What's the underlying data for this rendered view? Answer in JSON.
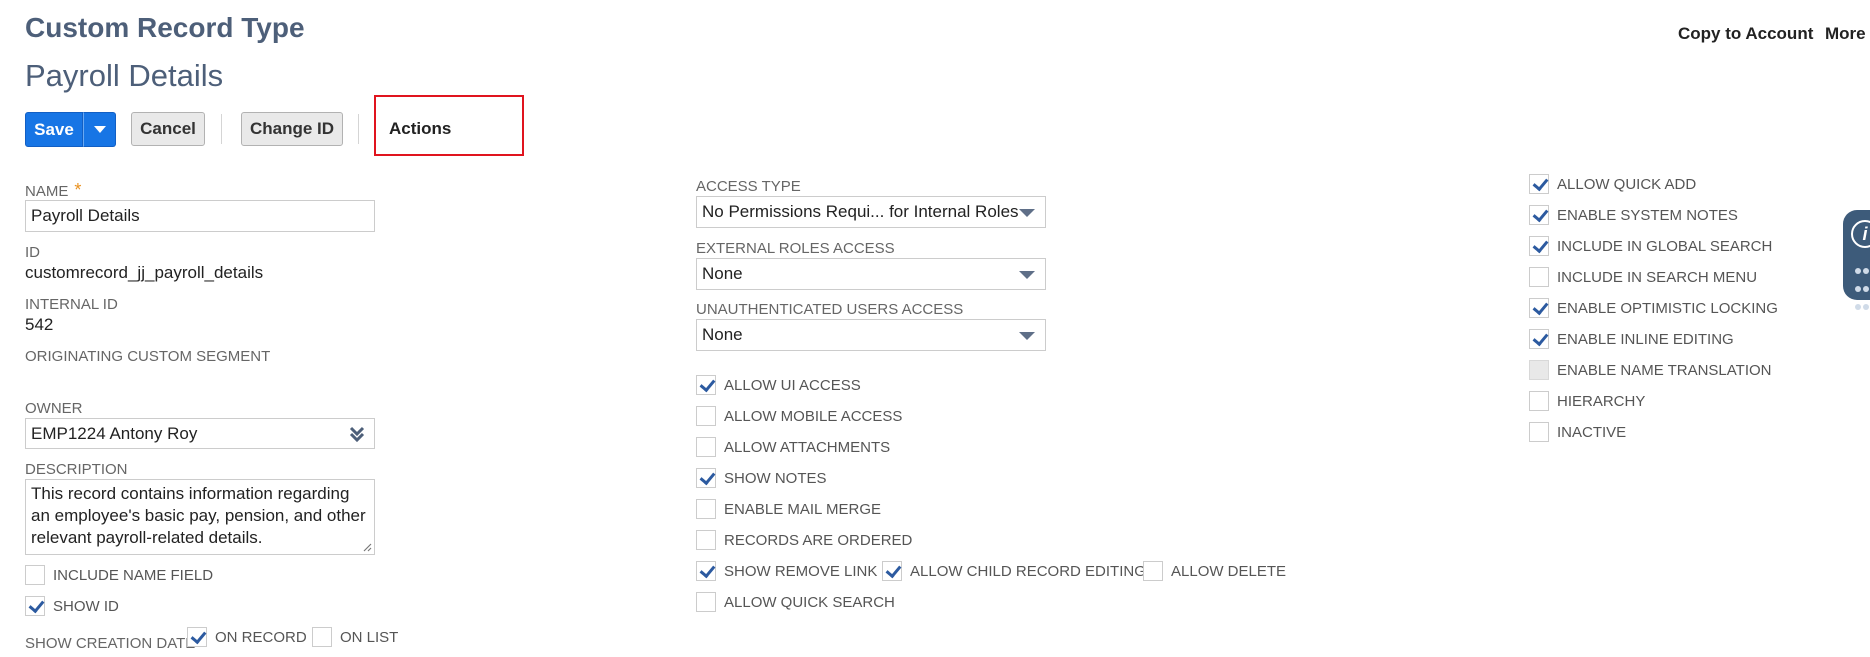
{
  "header": {
    "record_type": "Custom Record Type",
    "record_name": "Payroll Details",
    "copy_to_account": "Copy to Account",
    "more": "More"
  },
  "toolbar": {
    "save": "Save",
    "cancel": "Cancel",
    "change_id": "Change ID",
    "actions": "Actions"
  },
  "left": {
    "name_label": "NAME",
    "name_required": "*",
    "name_value": "Payroll Details",
    "id_label": "ID",
    "id_value": "customrecord_jj_payroll_details",
    "internal_id_label": "INTERNAL ID",
    "internal_id_value": "542",
    "originating_label": "ORIGINATING CUSTOM SEGMENT",
    "owner_label": "OWNER",
    "owner_value": "EMP1224 Antony Roy",
    "description_label": "DESCRIPTION",
    "description_lines": [
      "This record contains information regarding",
      "an employee's basic pay, pension, and other",
      "relevant payroll-related details."
    ],
    "include_name_field": "INCLUDE NAME FIELD",
    "show_id": "SHOW ID",
    "show_creation_date": "SHOW CREATION DATE",
    "on_record": "ON RECORD",
    "on_list": "ON LIST"
  },
  "middle": {
    "access_type_label": "ACCESS TYPE",
    "access_type_value": "No Permissions Requi... for Internal Roles",
    "external_roles_label": "EXTERNAL ROLES ACCESS",
    "external_roles_value": "None",
    "unauth_label": "UNAUTHENTICATED USERS ACCESS",
    "unauth_value": "None",
    "checkboxes": {
      "allow_ui_access": "ALLOW UI ACCESS",
      "allow_mobile_access": "ALLOW MOBILE ACCESS",
      "allow_attachments": "ALLOW ATTACHMENTS",
      "show_notes": "SHOW NOTES",
      "enable_mail_merge": "ENABLE MAIL MERGE",
      "records_are_ordered": "RECORDS ARE ORDERED",
      "show_remove_link": "SHOW REMOVE LINK",
      "allow_child_record_editing": "ALLOW CHILD RECORD EDITING",
      "allow_delete": "ALLOW DELETE",
      "allow_quick_search": "ALLOW QUICK SEARCH"
    }
  },
  "right": {
    "allow_quick_add": "ALLOW QUICK ADD",
    "enable_system_notes": "ENABLE SYSTEM NOTES",
    "include_in_global_search": "INCLUDE IN GLOBAL SEARCH",
    "include_in_search_menu": "INCLUDE IN SEARCH MENU",
    "enable_optimistic_locking": "ENABLE OPTIMISTIC LOCKING",
    "enable_inline_editing": "ENABLE INLINE EDITING",
    "enable_name_translation": "ENABLE NAME TRANSLATION",
    "hierarchy": "HIERARCHY",
    "inactive": "INACTIVE"
  },
  "icons": {
    "save_menu": "chevron-down-icon",
    "select_caret": "triangle-down-icon",
    "owner_chevron": "double-chevron-down-icon",
    "resize_handle": "resize-handle-icon",
    "help_widget": "info-icon"
  }
}
